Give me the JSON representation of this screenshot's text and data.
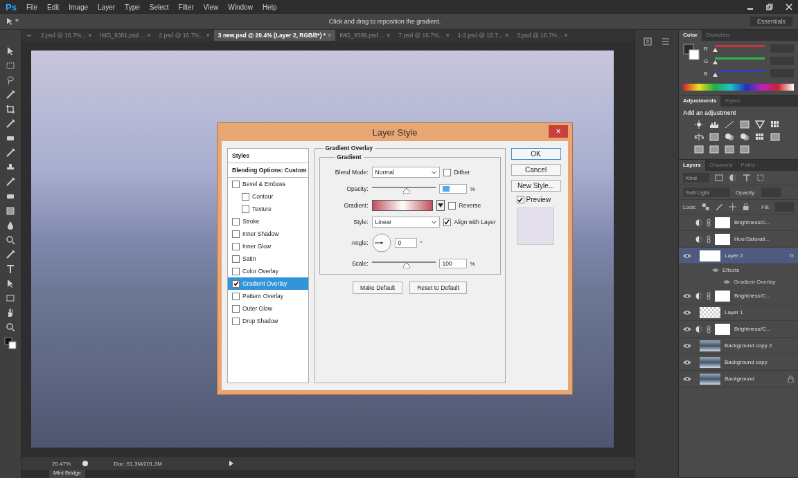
{
  "app": {
    "logo": "Ps",
    "menu": [
      "File",
      "Edit",
      "Image",
      "Layer",
      "Type",
      "Select",
      "Filter",
      "View",
      "Window",
      "Help"
    ],
    "hint": "Click and drag to reposition the gradient.",
    "workspace": "Essentials"
  },
  "document_tabs": [
    {
      "label": "2.psd @ 16.7%...",
      "close": "×",
      "selected": false
    },
    {
      "label": "IMG_9361.psd ...",
      "close": "×",
      "selected": false
    },
    {
      "label": "2.psd @ 16.7%...",
      "close": "×",
      "selected": false
    },
    {
      "label": "3 new.psd @ 20.4% (Layer 2, RGB/8*) *",
      "close": "×",
      "selected": true
    },
    {
      "label": "IMG_9389.psd ...",
      "close": "×",
      "selected": false
    },
    {
      "label": "7.psd @ 16.7%...",
      "close": "×",
      "selected": false
    },
    {
      "label": "1-2.psd @ 16.7...",
      "close": "×",
      "selected": false
    },
    {
      "label": "3.psd @ 16.7%...",
      "close": "×",
      "selected": false
    }
  ],
  "dialog": {
    "title": "Layer Style",
    "close": "×",
    "styles": [
      {
        "kind": "header",
        "label": "Styles",
        "selected": false
      },
      {
        "kind": "option",
        "label": "Blending Options: Custom",
        "selected": false
      },
      {
        "kind": "check",
        "label": "Bevel & Emboss",
        "checked": false,
        "selected": false,
        "children": [
          {
            "label": "Contour",
            "checked": false,
            "selected": false
          },
          {
            "label": "Texture",
            "checked": false,
            "selected": false
          }
        ]
      },
      {
        "kind": "check",
        "label": "Stroke",
        "checked": false,
        "selected": false
      },
      {
        "kind": "check",
        "label": "Inner Shadow",
        "checked": false,
        "selected": false
      },
      {
        "kind": "check",
        "label": "Inner Glow",
        "checked": false,
        "selected": false
      },
      {
        "kind": "check",
        "label": "Satin",
        "checked": false,
        "selected": false
      },
      {
        "kind": "check",
        "label": "Color Overlay",
        "checked": false,
        "selected": false
      },
      {
        "kind": "check",
        "label": "Gradient Overlay",
        "checked": true,
        "selected": true
      },
      {
        "kind": "check",
        "label": "Pattern Overlay",
        "checked": false,
        "selected": false
      },
      {
        "kind": "check",
        "label": "Outer Glow",
        "checked": false,
        "selected": false
      },
      {
        "kind": "check",
        "label": "Drop Shadow",
        "checked": false,
        "selected": false
      }
    ],
    "section_title": "Gradient Overlay",
    "group_title": "Gradient",
    "blend_mode": {
      "label": "Blend Mode:",
      "value": "Normal"
    },
    "dither": {
      "label": "Dither",
      "checked": false
    },
    "opacity": {
      "label": "Opacity:",
      "level": 0.55,
      "unit": "%"
    },
    "gradient": {
      "label": "Gradient:"
    },
    "reverse": {
      "label": "Reverse",
      "checked": false
    },
    "style": {
      "label": "Style:",
      "value": "Linear"
    },
    "align": {
      "label": "Align with Layer",
      "checked": true
    },
    "angle": {
      "label": "Angle:",
      "value": "0",
      "unit": "°"
    },
    "scale": {
      "label": "Scale:",
      "level": 0.55,
      "value": "100",
      "unit": "%"
    },
    "actions": [
      "Make Default",
      "Reset to Default"
    ],
    "buttons": [
      "OK",
      "Cancel",
      "New Style..."
    ],
    "preview": {
      "label": "Preview",
      "checked": true
    }
  },
  "color_panel": {
    "tabs": [
      {
        "label": "Color",
        "selected": true
      },
      {
        "label": "Swatches",
        "selected": false
      }
    ],
    "channels": [
      {
        "name": "R",
        "level": 0,
        "color": "#c8343c"
      },
      {
        "name": "G",
        "level": 0,
        "color": "#2fb84a"
      },
      {
        "name": "B",
        "level": 0,
        "color": "#3a3fb0"
      }
    ]
  },
  "adjustments_panel": {
    "tabs": [
      {
        "label": "Adjustments",
        "selected": true
      },
      {
        "label": "Styles",
        "selected": false
      }
    ],
    "heading": "Add an adjustment"
  },
  "layers_panel": {
    "tabs": [
      {
        "label": "Layers",
        "selected": true
      },
      {
        "label": "Channels",
        "selected": false
      },
      {
        "label": "Paths",
        "selected": false
      }
    ],
    "filter": "Kind",
    "blend": "Soft Light",
    "opacity_label": "Opacity:",
    "lock_label": "Lock:",
    "fill_label": "Fill:",
    "layers": [
      {
        "kind": "adjustment",
        "name": "Brightness/C...",
        "visible": false,
        "selected": false
      },
      {
        "kind": "adjustment",
        "name": "Hue/Saturati...",
        "visible": false,
        "selected": false
      },
      {
        "kind": "pixel",
        "name": "Layer 2",
        "visible": true,
        "selected": true,
        "fx": "fx",
        "children": [
          {
            "name": "Effects",
            "children": [
              {
                "name": "Gradient Overlay"
              }
            ]
          }
        ]
      },
      {
        "kind": "adjustment",
        "name": "Brightness/C...",
        "visible": true,
        "selected": false
      },
      {
        "kind": "transparent",
        "name": "Layer 1",
        "visible": true,
        "selected": false
      },
      {
        "kind": "adjustment",
        "name": "Brightness/C...",
        "visible": true,
        "selected": false
      },
      {
        "kind": "photo",
        "name": "Background copy 2",
        "visible": true,
        "selected": false
      },
      {
        "kind": "photo",
        "name": "Background copy",
        "visible": true,
        "selected": false
      },
      {
        "kind": "background",
        "name": "Background",
        "visible": true,
        "selected": false,
        "locked": true
      }
    ]
  },
  "status_bar": {
    "zoom": "20.47%",
    "doc": "Doc: 51.3M/201.3M",
    "panel_tabs": [
      {
        "label": "Mini Bridge",
        "selected": true
      }
    ]
  }
}
